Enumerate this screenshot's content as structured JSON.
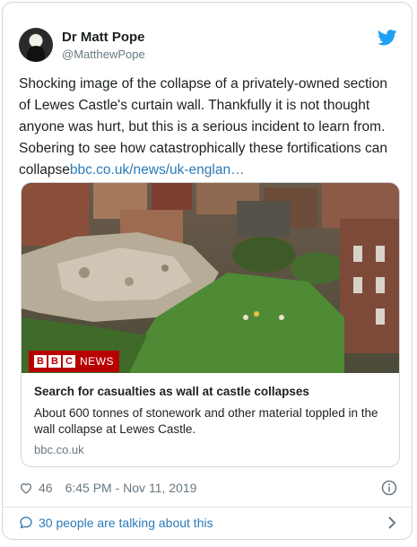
{
  "author": {
    "name": "Dr Matt Pope",
    "handle": "@MatthewPope"
  },
  "tweet": {
    "text": "Shocking image of the collapse of a privately-owned section of Lewes Castle's curtain wall. Thankfully it is not thought anyone was hurt, but this is a serious incident to learn from. Sobering to see how catastrophically these fortifications can collapse",
    "link_text": "bbc.co.uk/news/uk-englan…"
  },
  "card": {
    "badge_letters": [
      "B",
      "B",
      "C"
    ],
    "badge_word": "NEWS",
    "title": "Search for casualties as wall at castle collapses",
    "description": "About 600 tonnes of stonework and other material toppled in the wall collapse at Lewes Castle.",
    "domain": "bbc.co.uk"
  },
  "meta": {
    "likes": "46",
    "timestamp": "6:45 PM - Nov 11, 2019"
  },
  "footer": {
    "talking": "30 people are talking about this"
  },
  "colors": {
    "twitter_blue": "#1da1f2",
    "link_blue": "#2b7bb9",
    "bbc_red": "#b80000",
    "muted_gray": "#697882",
    "border": "#cfd9de"
  },
  "icons": {
    "bird": "twitter-bird-icon",
    "heart": "heart-icon",
    "info": "info-icon",
    "bubble": "speech-bubble-icon",
    "chevron": "chevron-right-icon"
  }
}
